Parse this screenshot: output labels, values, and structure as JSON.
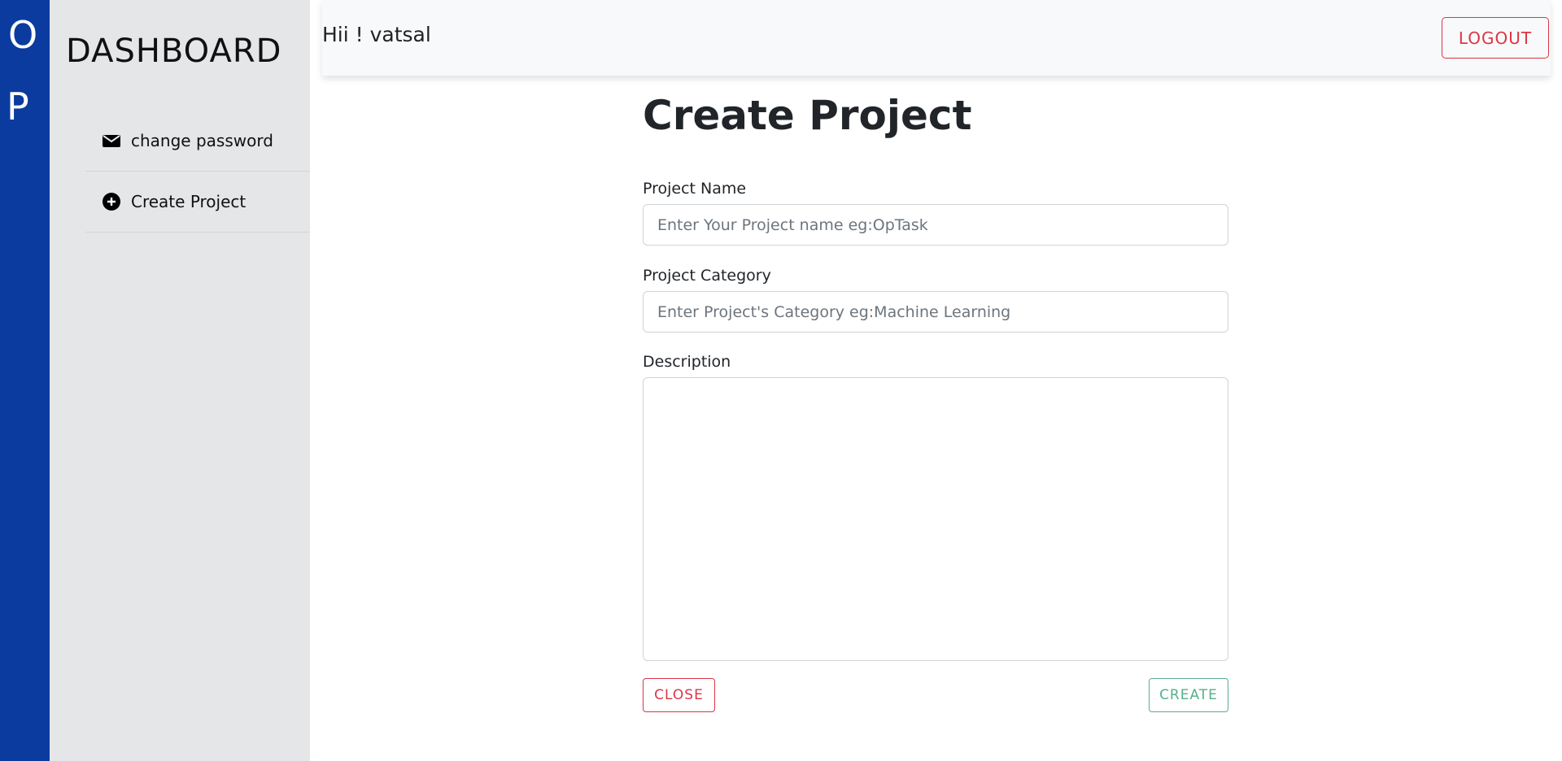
{
  "brand": {
    "letters": [
      "O",
      "P"
    ],
    "color": "#0b3b9f"
  },
  "sidebar": {
    "title": "DASHBOARD",
    "items": [
      {
        "label": "change password",
        "icon": "envelope-icon"
      },
      {
        "label": "Create Project",
        "icon": "plus-circle-icon"
      }
    ]
  },
  "header": {
    "greeting": "Hii ! vatsal",
    "logout_label": "LOGOUT"
  },
  "form": {
    "title": "Create Project",
    "project_name": {
      "label": "Project Name",
      "placeholder": "Enter Your Project name eg:OpTask",
      "value": ""
    },
    "project_category": {
      "label": "Project Category",
      "placeholder": "Enter Project's Category eg:Machine Learning",
      "value": ""
    },
    "description": {
      "label": "Description",
      "value": ""
    },
    "close_label": "CLOSE",
    "create_label": "CREATE"
  },
  "colors": {
    "danger": "#dc3545",
    "success": "#56b08a",
    "sidebar_bg": "#e5e6e8"
  }
}
